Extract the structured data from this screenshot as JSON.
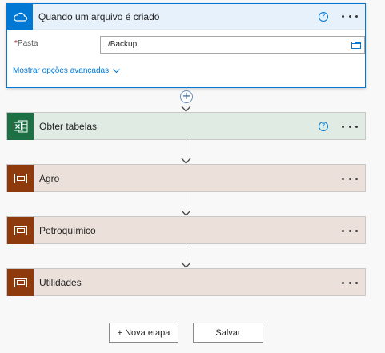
{
  "trigger": {
    "title": "Quando um arquivo é criado",
    "icon": "onedrive-cloud-icon",
    "help": "?",
    "field": {
      "required_mark": "*",
      "label": "Pasta",
      "value": "/Backup"
    },
    "advanced_link": "Mostrar opções avançadas"
  },
  "excel": {
    "title": "Obter tabelas",
    "icon": "excel-icon",
    "help": "?"
  },
  "scopes": [
    {
      "title": "Agro"
    },
    {
      "title": "Petroquímico"
    },
    {
      "title": "Utilidades"
    }
  ],
  "add_step_symbol": "+",
  "buttons": {
    "new_step": "+ Nova etapa",
    "save": "Salvar"
  },
  "colors": {
    "trigger_accent": "#0078d4",
    "excel_green": "#1d7044",
    "scope_brown": "#8f3a0c",
    "link_blue": "#0078d4"
  }
}
